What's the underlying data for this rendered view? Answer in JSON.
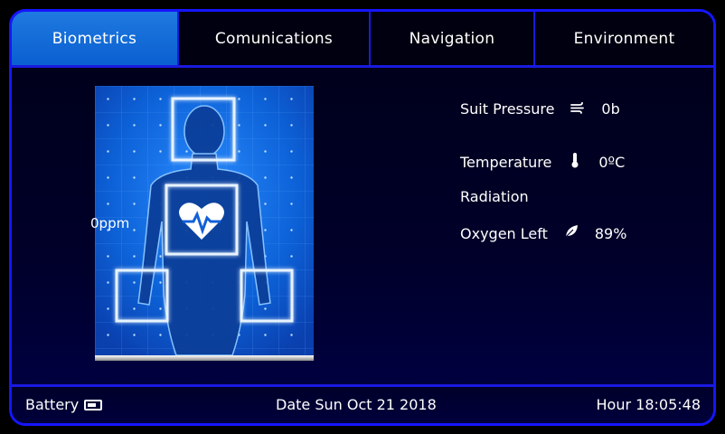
{
  "tabs": [
    {
      "label": "Biometrics",
      "active": true
    },
    {
      "label": "Comunications",
      "active": false
    },
    {
      "label": "Navigation",
      "active": false
    },
    {
      "label": "Environment",
      "active": false
    }
  ],
  "biometrics": {
    "heart_rate": "0ppm"
  },
  "stats": {
    "suit_pressure_label": "Suit Pressure",
    "suit_pressure_value": "0b",
    "temperature_label": "Temperature",
    "temperature_value": "0ºC",
    "radiation_label": "Radiation",
    "oxygen_label": "Oxygen Left",
    "oxygen_value": "89%"
  },
  "footer": {
    "battery_label": "Battery",
    "date": "Date Sun Oct 21 2018",
    "hour": "Hour 18:05:48"
  },
  "colors": {
    "border": "#1515ff",
    "active_tab": "#1f7ae0",
    "background": "#000018"
  }
}
